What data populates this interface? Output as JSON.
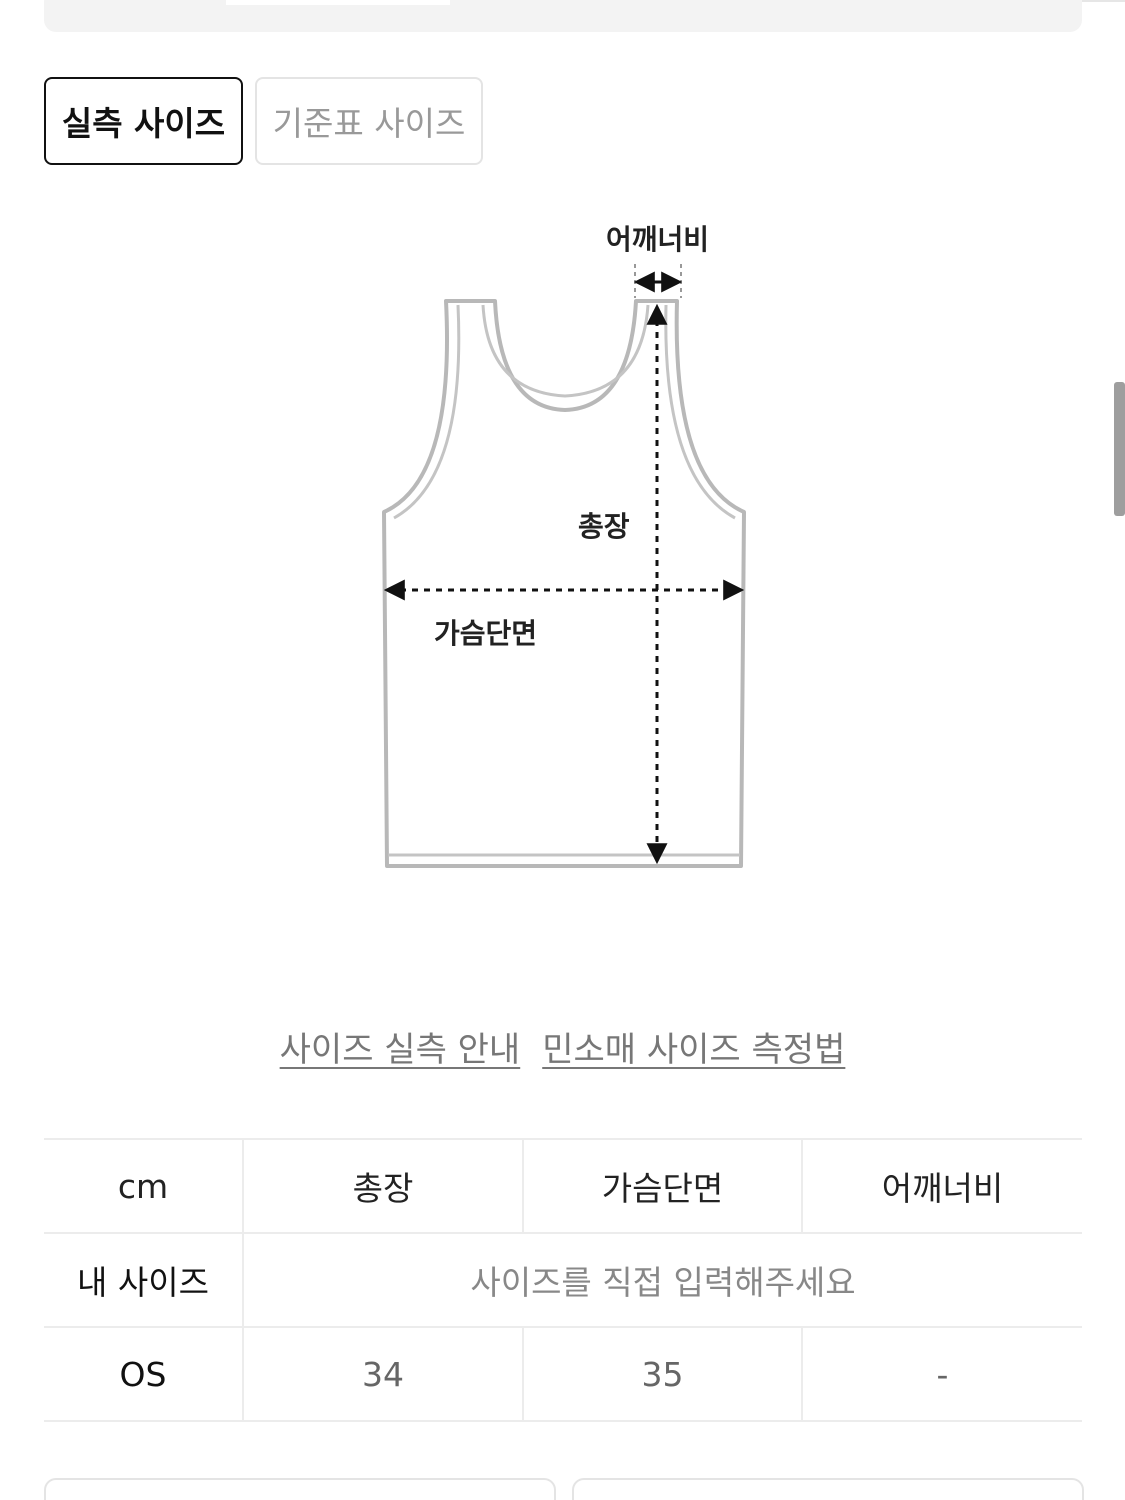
{
  "tabs": [
    {
      "label": "실측 사이즈",
      "active": true
    },
    {
      "label": "기준표 사이즈",
      "active": false
    }
  ],
  "diagram": {
    "shoulder_label": "어깨너비",
    "length_label": "총장",
    "chest_label": "가슴단면"
  },
  "links": {
    "size_guide": "사이즈 실측 안내",
    "measure_method": "민소매 사이즈 측정법"
  },
  "table": {
    "headers": [
      "cm",
      "총장",
      "가슴단면",
      "어깨너비"
    ],
    "my_size_row": {
      "label": "내 사이즈",
      "placeholder": "사이즈를 직접 입력해주세요"
    },
    "rows": [
      {
        "size": "OS",
        "values": [
          "34",
          "35",
          "-"
        ]
      }
    ]
  },
  "colors": {
    "active_border": "#111111",
    "inactive_text": "#999999",
    "link_text": "#777777",
    "table_border": "#ececec"
  }
}
